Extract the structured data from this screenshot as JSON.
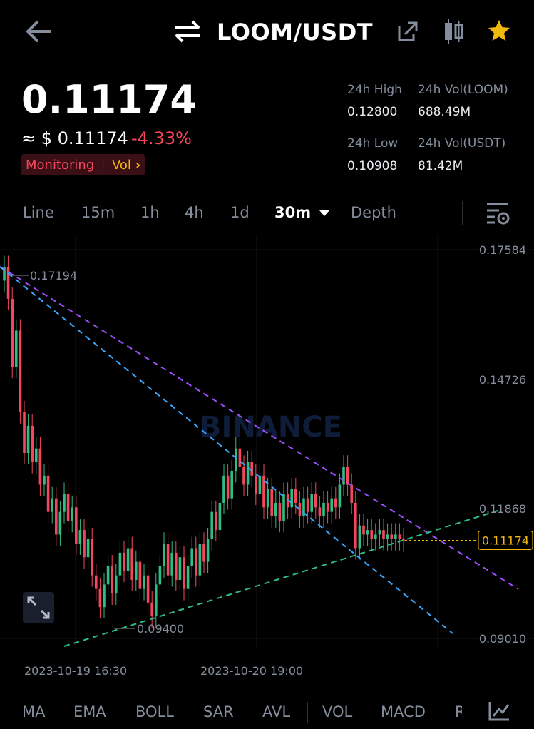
{
  "header": {
    "back_icon": "arrow-left-icon",
    "swap_icon": "swap-icon",
    "pair": "LOOM/USDT",
    "share_icon": "share-icon",
    "candle_icon": "candlestick-icon",
    "star_icon": "star-icon"
  },
  "price": {
    "last": "0.11174",
    "approx": "≈ $ 0.11174",
    "change": "-4.33%",
    "badge_monitoring": "Monitoring",
    "badge_vol": "Vol",
    "badge_chevron": "›"
  },
  "stats": {
    "high_label": "24h High",
    "high_value": "0.12800",
    "volb_label": "24h Vol(LOOM)",
    "volb_value": "688.49M",
    "low_label": "24h Low",
    "low_value": "0.10908",
    "volq_label": "24h Vol(USDT)",
    "volq_value": "81.42M"
  },
  "tabs": {
    "line": "Line",
    "m15": "15m",
    "h1": "1h",
    "h4": "4h",
    "d1": "1d",
    "m30": "30m",
    "depth": "Depth",
    "settings_icon": "chart-settings-icon"
  },
  "chart_data": {
    "type": "candlestick",
    "watermark": "BINANCE",
    "y_ticks": [
      "0.17584",
      "0.14726",
      "0.11868",
      "0.09010"
    ],
    "y_tick_values": [
      0.17584,
      0.14726,
      0.11868,
      0.0901
    ],
    "x_ticks": [
      "2023-10-19 16:30",
      "2023-10-20 19:00"
    ],
    "high_marker": "0.17194",
    "low_marker": "0.09400",
    "last_price_label": "0.11174",
    "last_price": 0.11174,
    "closes": [
      0.172,
      0.165,
      0.15,
      0.158,
      0.14,
      0.131,
      0.137,
      0.129,
      0.132,
      0.124,
      0.126,
      0.118,
      0.121,
      0.113,
      0.118,
      0.122,
      0.116,
      0.119,
      0.111,
      0.114,
      0.108,
      0.112,
      0.104,
      0.101,
      0.097,
      0.102,
      0.106,
      0.1,
      0.104,
      0.109,
      0.105,
      0.11,
      0.103,
      0.107,
      0.101,
      0.104,
      0.098,
      0.095,
      0.102,
      0.106,
      0.111,
      0.104,
      0.109,
      0.103,
      0.108,
      0.101,
      0.106,
      0.11,
      0.104,
      0.111,
      0.107,
      0.112,
      0.118,
      0.114,
      0.12,
      0.126,
      0.121,
      0.127,
      0.132,
      0.128,
      0.124,
      0.129,
      0.126,
      0.122,
      0.126,
      0.119,
      0.123,
      0.117,
      0.12,
      0.116,
      0.122,
      0.119,
      0.123,
      0.12,
      0.117,
      0.121,
      0.118,
      0.122,
      0.119,
      0.117,
      0.12,
      0.118,
      0.121,
      0.119,
      0.124,
      0.128,
      0.124,
      0.12,
      0.11,
      0.115,
      0.113,
      0.114,
      0.112,
      0.113,
      0.114,
      0.112,
      0.113,
      0.112,
      0.113,
      0.112,
      0.1117
    ],
    "expand_icon": "expand-icon"
  },
  "indicators": {
    "ma": "MA",
    "ema": "EMA",
    "boll": "BOLL",
    "sar": "SAR",
    "avl": "AVL",
    "vol": "VOL",
    "macd": "MACD",
    "more": "R",
    "drawing_icon": "drawing-tools-icon"
  },
  "colors": {
    "up": "#2ebd85",
    "down": "#f6465d",
    "accent": "#f0b90b",
    "trend_purple": "#a04fff",
    "trend_blue": "#3aa8ff",
    "trend_green": "#2ebd85"
  }
}
